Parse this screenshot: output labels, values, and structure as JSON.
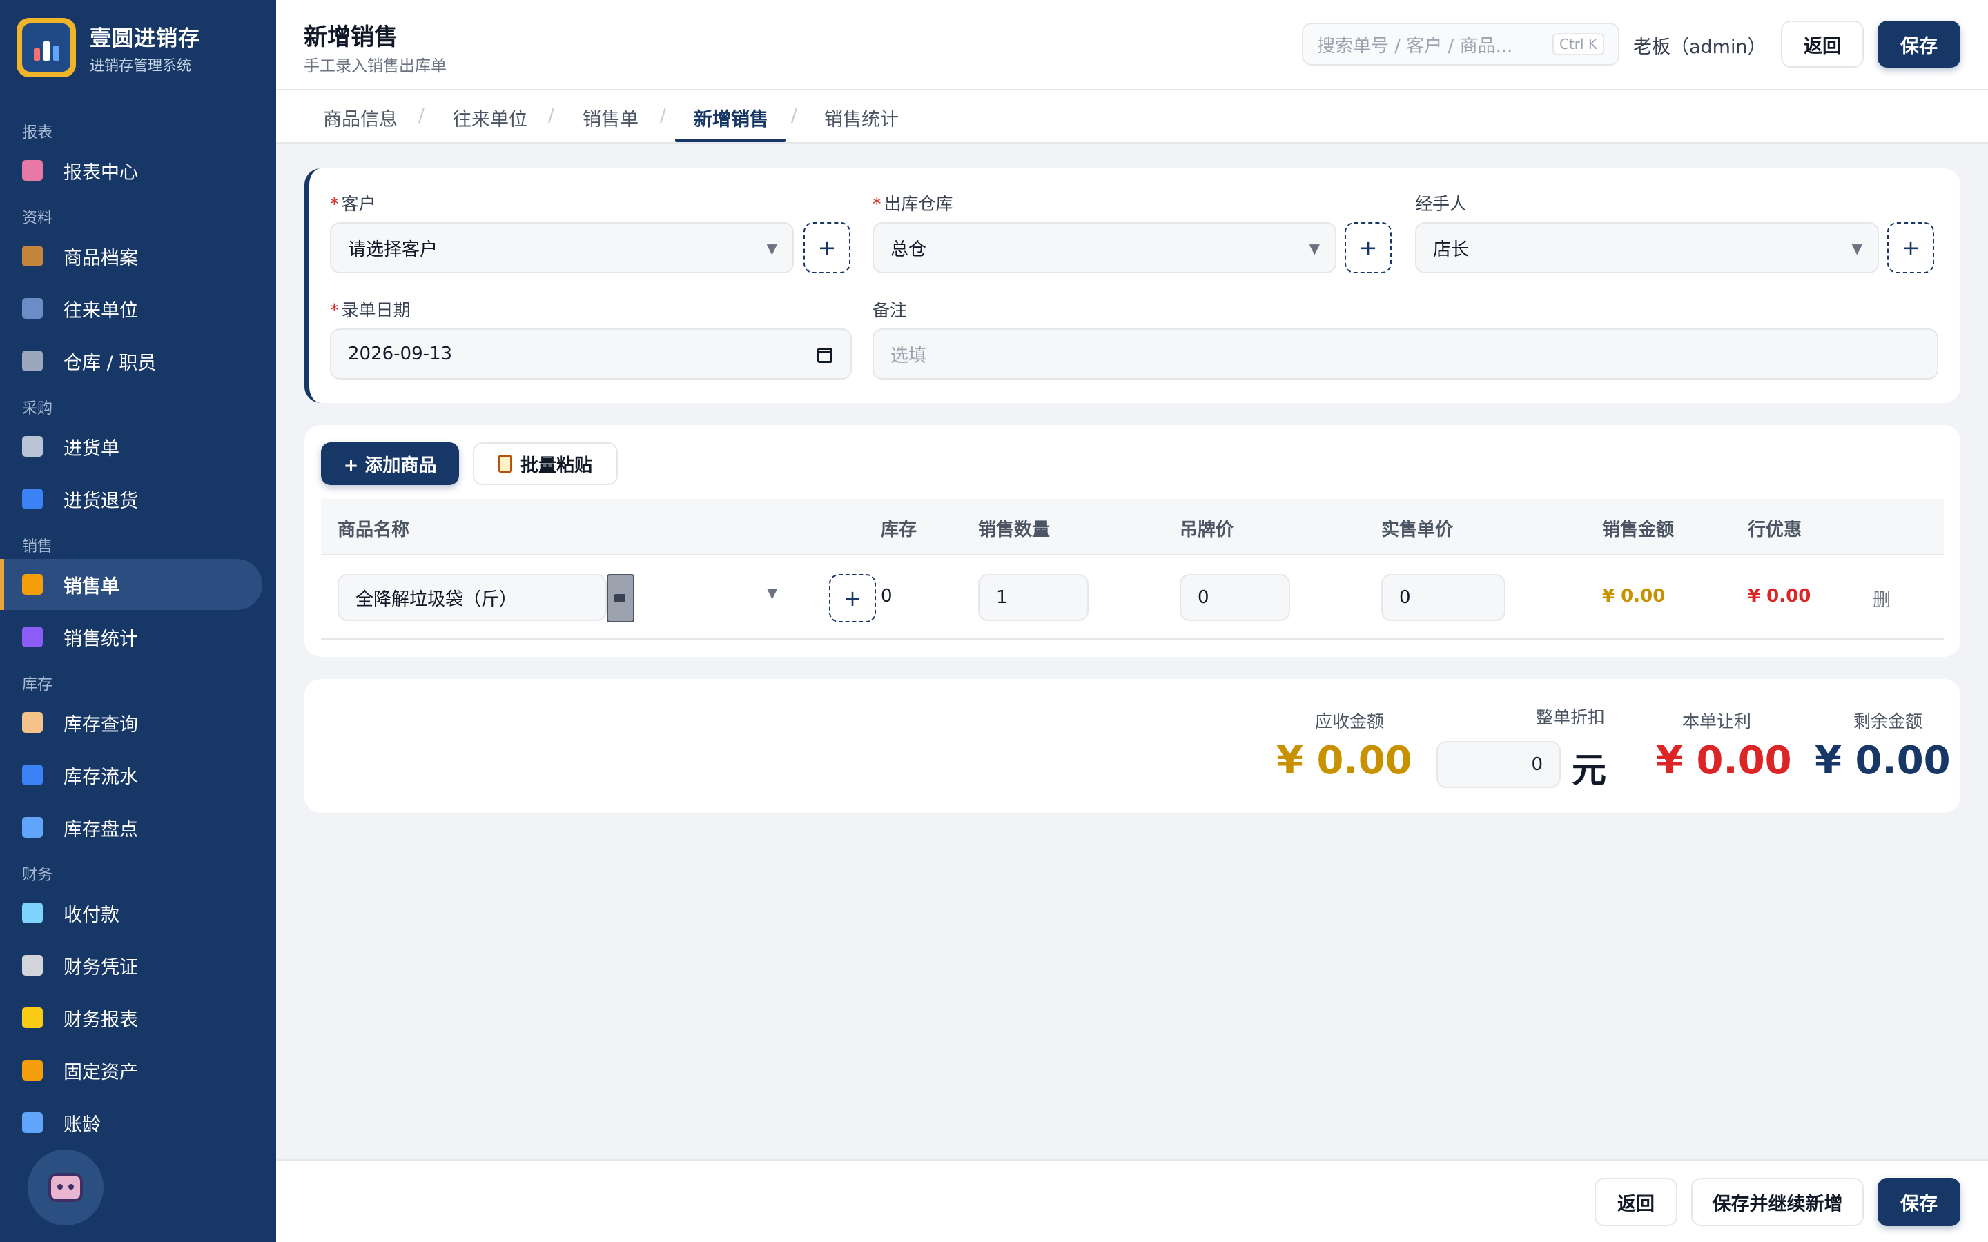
{
  "brand": {
    "name": "壹圆进销存",
    "subtitle": "进销存管理系统"
  },
  "sidebar": {
    "sections": [
      {
        "title": "报表",
        "items": [
          {
            "label": "报表中心",
            "icon": "report-icon",
            "color": "#e879a6"
          }
        ]
      },
      {
        "title": "资料",
        "items": [
          {
            "label": "商品档案",
            "icon": "package-icon",
            "color": "#c2853b"
          },
          {
            "label": "往来单位",
            "icon": "building-icon",
            "color": "#6b8cc7"
          },
          {
            "label": "仓库 / 职员",
            "icon": "factory-icon",
            "color": "#9aa7bd"
          }
        ]
      },
      {
        "title": "采购",
        "items": [
          {
            "label": "进货单",
            "icon": "inbox-icon",
            "color": "#b8c4d6"
          },
          {
            "label": "进货退货",
            "icon": "return-icon",
            "color": "#3b82f6"
          }
        ]
      },
      {
        "title": "销售",
        "items": [
          {
            "label": "销售单",
            "icon": "money-bag-icon",
            "color": "#f59e0b",
            "active": true
          },
          {
            "label": "销售统计",
            "icon": "bar-chart-icon",
            "color": "#8b5cf6"
          }
        ]
      },
      {
        "title": "库存",
        "items": [
          {
            "label": "库存查询",
            "icon": "clipboard-icon",
            "color": "#f3c38a"
          },
          {
            "label": "库存流水",
            "icon": "wave-icon",
            "color": "#3b82f6"
          },
          {
            "label": "库存盘点",
            "icon": "magnifier-icon",
            "color": "#60a5fa"
          }
        ]
      },
      {
        "title": "财务",
        "items": [
          {
            "label": "收付款",
            "icon": "credit-card-icon",
            "color": "#7dd3fc"
          },
          {
            "label": "财务凭证",
            "icon": "receipt-icon",
            "color": "#d1d5db"
          },
          {
            "label": "财务报表",
            "icon": "ledger-icon",
            "color": "#facc15"
          },
          {
            "label": "固定资产",
            "icon": "crane-icon",
            "color": "#f59e0b"
          },
          {
            "label": "账龄",
            "icon": "chart-icon",
            "color": "#60a5fa"
          }
        ]
      }
    ]
  },
  "header": {
    "title": "新增销售",
    "subtitle": "手工录入销售出库单",
    "search_placeholder": "搜索单号 / 客户 / 商品...",
    "search_shortcut": "Ctrl K",
    "user": "老板（admin）",
    "back_label": "返回",
    "save_label": "保存"
  },
  "tabs": [
    {
      "label": "商品信息"
    },
    {
      "label": "往来单位"
    },
    {
      "label": "销售单"
    },
    {
      "label": "新增销售",
      "active": true
    },
    {
      "label": "销售统计"
    }
  ],
  "form": {
    "customer": {
      "label": "客户",
      "value": "请选择客户",
      "required": true
    },
    "warehouse": {
      "label": "出库仓库",
      "value": "总仓",
      "required": true
    },
    "handler": {
      "label": "经手人",
      "value": "店长"
    },
    "date": {
      "label": "录单日期",
      "value": "2026-09-13",
      "required": true
    },
    "note": {
      "label": "备注",
      "placeholder": "选填"
    },
    "add_symbol": "+",
    "required_mark": "*"
  },
  "items": {
    "add_button": "+ 添加商品",
    "paste_button": "批量粘贴",
    "columns": [
      "商品名称",
      "库存",
      "销售数量",
      "吊牌价",
      "实售单价",
      "销售金额",
      "行优惠"
    ],
    "rows": [
      {
        "name": "全降解垃圾袋（斤）",
        "stock": "0",
        "qty": "1",
        "tag_price": "0",
        "unit_price": "0",
        "amount": "¥ 0.00",
        "discount": "¥ 0.00",
        "delete_label": "删"
      }
    ]
  },
  "summary": {
    "receivable_label": "应收金额",
    "receivable_value": "¥ 0.00",
    "discount_label": "整单折扣",
    "discount_value": "0",
    "discount_unit": "元",
    "profit_label": "本单让利",
    "profit_value": "¥ 0.00",
    "remaining_label": "剩余金额",
    "remaining_value": "¥ 0.00"
  },
  "footer": {
    "back_label": "返回",
    "save_continue_label": "保存并继续新增",
    "save_label": "保存"
  },
  "colors": {
    "primary": "#173766",
    "accent": "#e8a33c",
    "gold": "#c79100",
    "red": "#dc2626"
  }
}
